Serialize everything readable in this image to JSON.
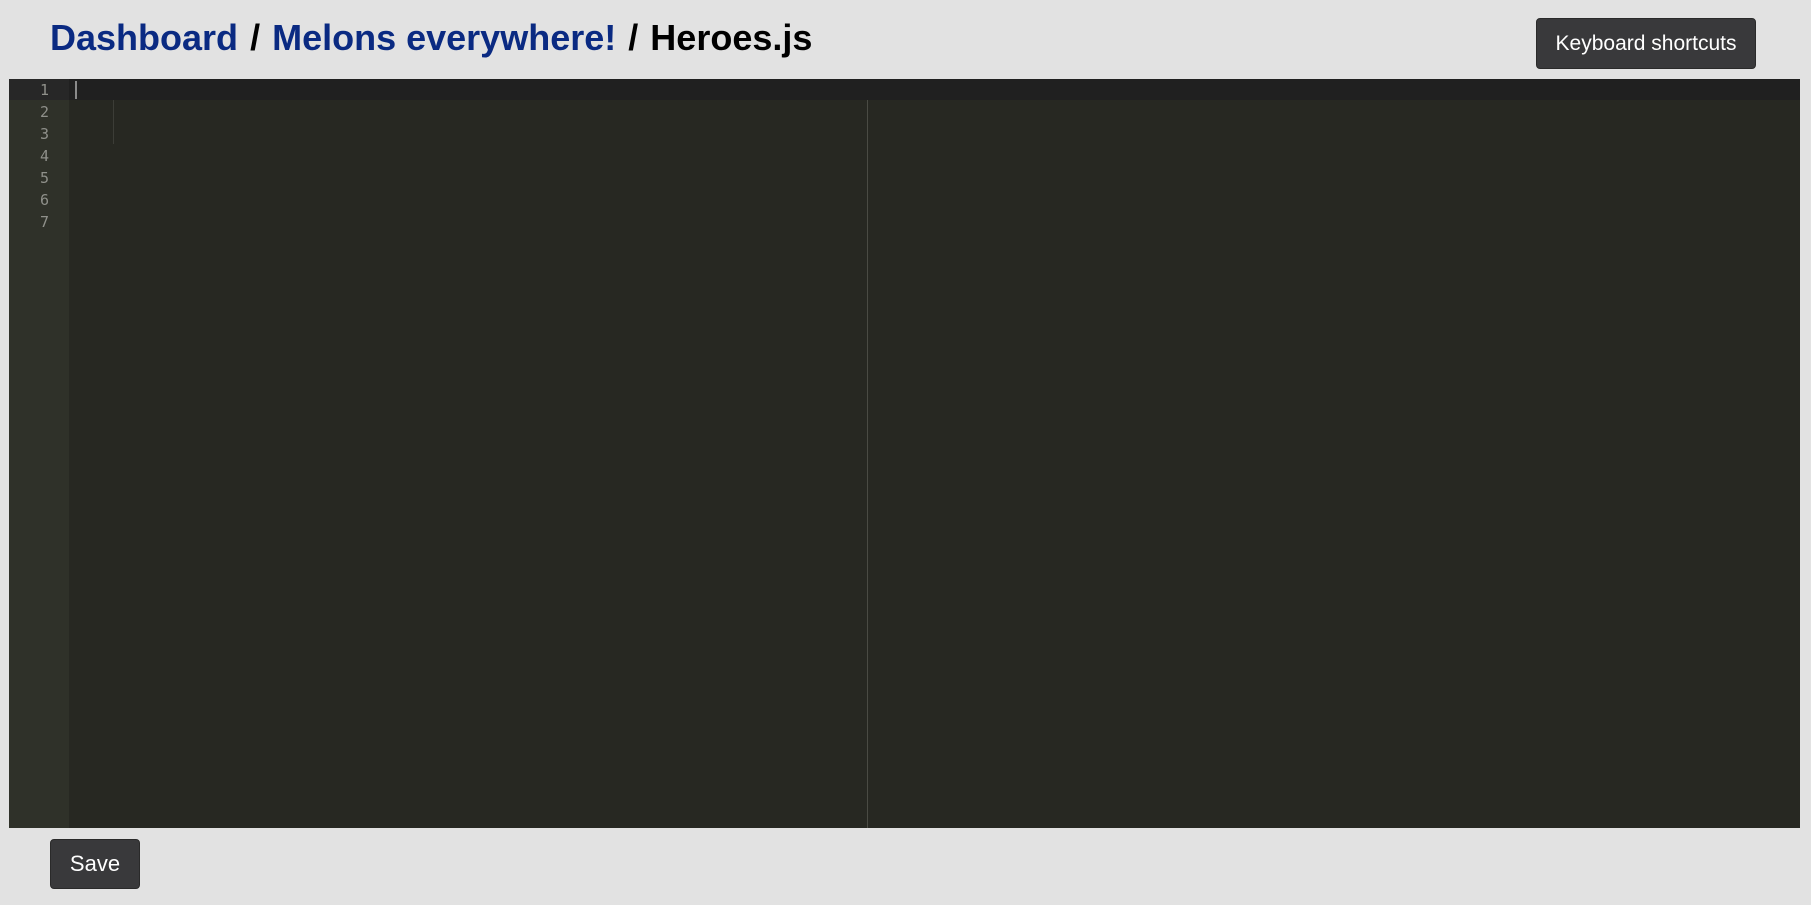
{
  "breadcrumb": {
    "dashboard": "Dashboard",
    "separator": "/",
    "project": "Melons everywhere!",
    "file": "Heroes.js"
  },
  "toolbar": {
    "shortcuts_label": "Keyboard shortcuts",
    "save_label": "Save"
  },
  "editor": {
    "line_numbers": [
      "1",
      "2",
      "3",
      "4",
      "5",
      "6",
      "7"
    ],
    "theme_colors": {
      "background": "#272822",
      "gutter": "#2f3129",
      "active_line": "#202020",
      "line_number": "#8f908a"
    }
  },
  "colors": {
    "page_background": "#e2e2e2",
    "link": "#0a2a82",
    "button_background": "#39393b",
    "button_text": "#ffffff"
  }
}
